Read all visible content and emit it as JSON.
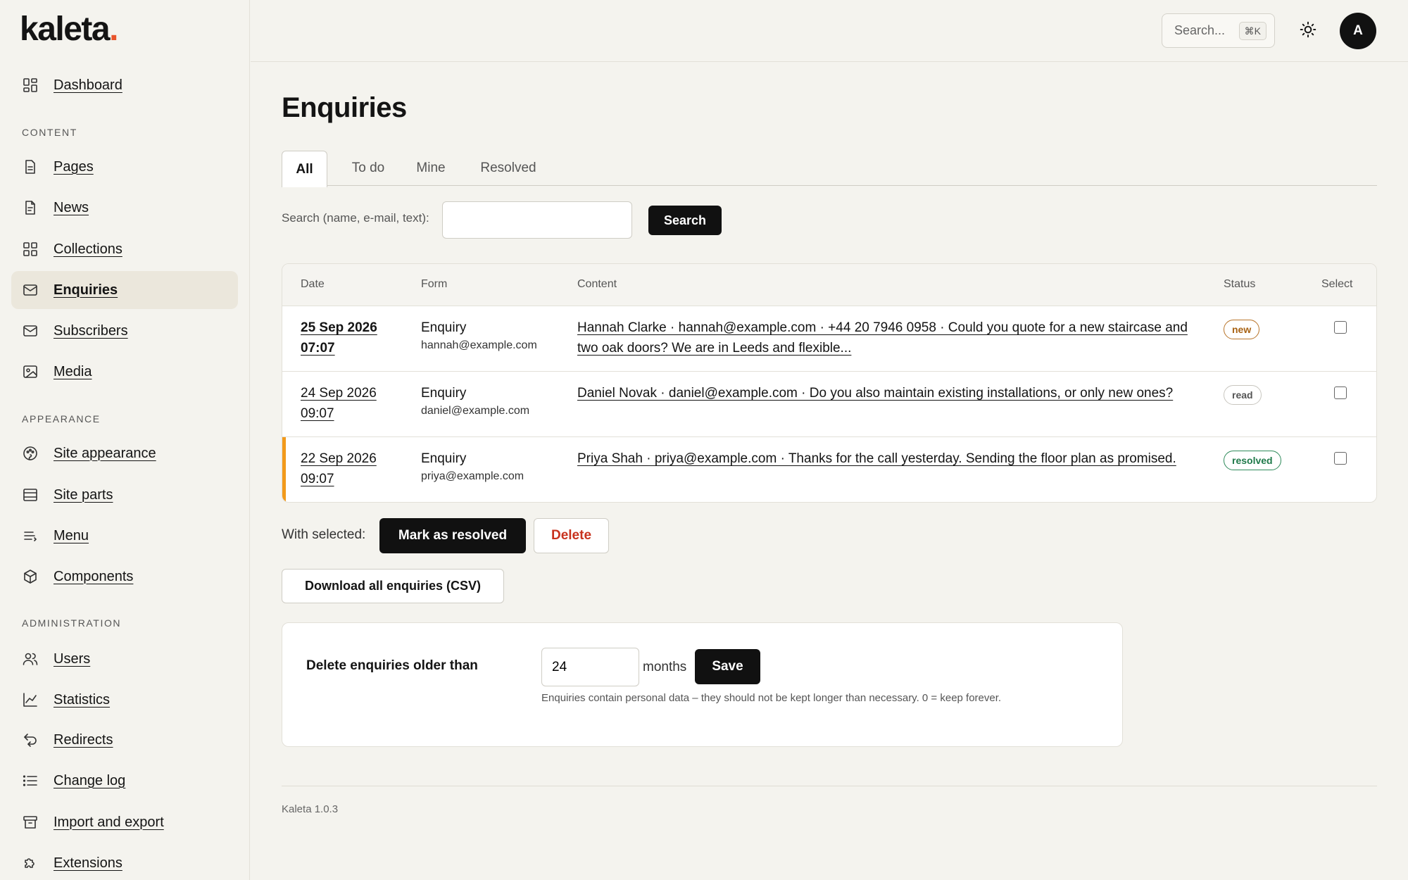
{
  "brand": {
    "logo_text": "kaleta",
    "logo_dot": ".",
    "accent": "#e8542b"
  },
  "sidebar": {
    "dashboard": {
      "label": "Dashboard",
      "icon": "dashboard-grid-icon"
    },
    "sections": [
      {
        "title": "CONTENT",
        "items": [
          {
            "label": "Pages",
            "icon": "page-icon"
          },
          {
            "label": "News",
            "icon": "document-icon"
          },
          {
            "label": "Collections",
            "icon": "grid-icon"
          },
          {
            "label": "Enquiries",
            "icon": "mail-icon",
            "active": true
          },
          {
            "label": "Subscribers",
            "icon": "mail-icon"
          },
          {
            "label": "Media",
            "icon": "image-icon"
          }
        ]
      },
      {
        "title": "APPEARANCE",
        "items": [
          {
            "label": "Site appearance",
            "icon": "palette-icon"
          },
          {
            "label": "Site parts",
            "icon": "layout-icon"
          },
          {
            "label": "Menu",
            "icon": "menu-icon"
          },
          {
            "label": "Components",
            "icon": "cube-icon"
          }
        ]
      },
      {
        "title": "ADMINISTRATION",
        "items": [
          {
            "label": "Users",
            "icon": "users-icon"
          },
          {
            "label": "Statistics",
            "icon": "chart-icon"
          },
          {
            "label": "Redirects",
            "icon": "redirect-icon"
          },
          {
            "label": "Change log",
            "icon": "list-icon"
          },
          {
            "label": "Import and export",
            "icon": "archive-icon"
          },
          {
            "label": "Extensions",
            "icon": "puzzle-icon"
          }
        ]
      }
    ]
  },
  "topbar": {
    "search_placeholder": "Search...",
    "search_shortcut": "⌘K",
    "theme_icon": "sun-icon",
    "avatar_initial": "A"
  },
  "page": {
    "title": "Enquiries",
    "tabs": [
      {
        "label": "All",
        "active": true
      },
      {
        "label": "To do"
      },
      {
        "label": "Mine"
      },
      {
        "label": "Resolved"
      }
    ],
    "search_label": "Search (name, e-mail, text):",
    "search_value": "",
    "search_button": "Search"
  },
  "table": {
    "headers": {
      "date": "Date",
      "form": "Form",
      "content": "Content",
      "status": "Status",
      "select": "Select"
    },
    "rows": [
      {
        "date_line1": "25 Sep 2026",
        "date_line2": "07:07",
        "form": "Enquiry",
        "email": "hannah@example.com",
        "content": "Hannah Clarke · hannah@example.com · +44 20 7946 0958 · Could you quote for a new staircase and two oak doors? We are in Leeds and flexible...",
        "status": "new",
        "bold": true,
        "checked": false
      },
      {
        "date_line1": "24 Sep 2026",
        "date_line2": "09:07",
        "form": "Enquiry",
        "email": "daniel@example.com",
        "content": "Daniel Novak · daniel@example.com · Do you also maintain existing installations, or only new ones?",
        "status": "read",
        "checked": false
      },
      {
        "date_line1": "22 Sep 2026",
        "date_line2": "09:07",
        "form": "Enquiry",
        "email": "priya@example.com",
        "content": "Priya Shah · priya@example.com · Thanks for the call yesterday. Sending the floor plan as promised.",
        "status": "resolved",
        "flagged": true,
        "checked": false
      }
    ]
  },
  "bulk": {
    "label": "With selected:",
    "resolve": "Mark as resolved",
    "delete": "Delete"
  },
  "export": {
    "csv": "Download all enquiries (CSV)"
  },
  "retention": {
    "label": "Delete enquiries older than",
    "value": "24",
    "unit": "months",
    "save": "Save",
    "help": "Enquiries contain personal data – they should not be kept longer than necessary. 0 = keep forever."
  },
  "footer": {
    "version": "Kaleta 1.0.3"
  },
  "colors": {
    "flag": "#f29a1b",
    "badge_new": "#a86213",
    "badge_resolved": "#1f7a4a",
    "delete": "#c8321e"
  }
}
